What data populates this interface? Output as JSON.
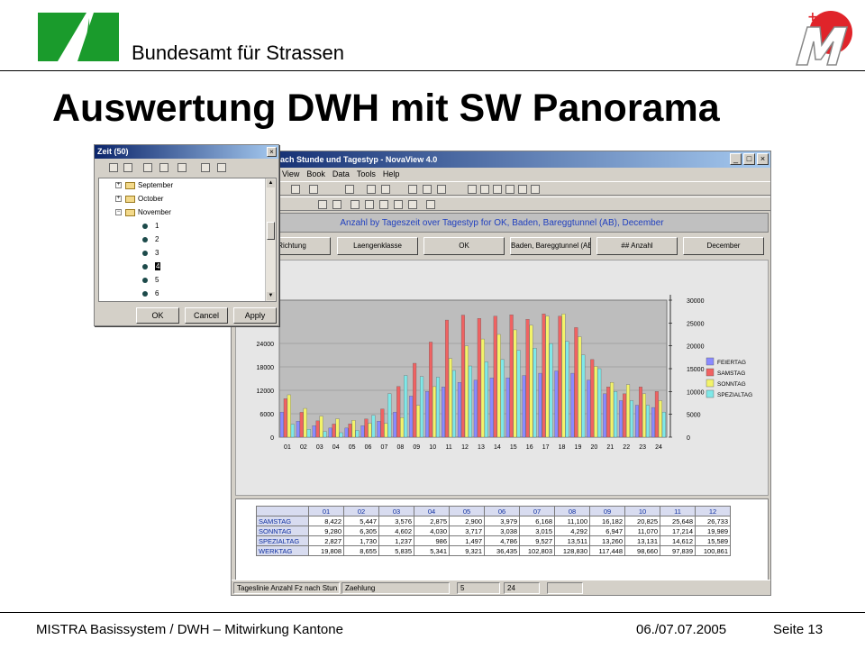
{
  "header": {
    "org_name": "Bundesamt für Strassen",
    "title": "Auswertung DWH mit SW Panorama"
  },
  "footer": {
    "left": "MISTRA Basissystem / DWH – Mitwirkung Kantone",
    "date": "06./07.07.2005",
    "page": "Seite 13"
  },
  "window": {
    "title": "Anzahl Fz nach Stunde und Tagestyp - NovaView 4.0",
    "menu": [
      "View",
      "Book",
      "Data",
      "Tools",
      "Help"
    ],
    "chart_header": "Anzahl by Tageszeit over Tagestyp for OK, Baden, Bareggtunnel (AB), December",
    "dimension_buttons": [
      "Richtung",
      "Laengenklasse",
      "OK",
      "Baden, Bareggtunnel (AB)",
      "## Anzahl",
      "December"
    ],
    "status": {
      "tab1": "Tageslinie Anzahl Fz nach Stun",
      "tab2": "Zaehlung",
      "rows": "5",
      "cols": "24"
    }
  },
  "dialog": {
    "title": "Zeit (50)",
    "tree": [
      {
        "label": "September",
        "expanded": false
      },
      {
        "label": "October",
        "expanded": false
      },
      {
        "label": "November",
        "expanded": true
      }
    ],
    "days": [
      "1",
      "2",
      "3",
      "4",
      "5",
      "6"
    ],
    "selected_day": "4",
    "buttons": {
      "ok": "OK",
      "cancel": "Cancel",
      "apply": "Apply"
    }
  },
  "grid": {
    "columns": [
      "01",
      "02",
      "03",
      "04",
      "05",
      "06",
      "07",
      "08",
      "09",
      "10",
      "11",
      "12"
    ],
    "rows": [
      {
        "label": "SAMSTAG",
        "values": [
          "8,422",
          "5,447",
          "3,576",
          "2,875",
          "2,900",
          "3,979",
          "6,168",
          "11,100",
          "16,182",
          "20,825",
          "25,648",
          "26,733"
        ]
      },
      {
        "label": "SONNTAG",
        "values": [
          "9,280",
          "6,305",
          "4,602",
          "4,030",
          "3,717",
          "3,038",
          "3,015",
          "4,292",
          "6,947",
          "11,070",
          "17,214",
          "19,989"
        ]
      },
      {
        "label": "SPEZIALTAG",
        "values": [
          "2,827",
          "1,730",
          "1,237",
          "986",
          "1,497",
          "4,786",
          "9,527",
          "13,511",
          "13,260",
          "13,131",
          "14,612",
          "15,589"
        ]
      },
      {
        "label": "WERKTAG",
        "values": [
          "19,808",
          "8,655",
          "5,835",
          "5,341",
          "9,321",
          "36,435",
          "102,803",
          "128,830",
          "117,448",
          "98,660",
          "97,839",
          "100,861"
        ]
      }
    ]
  },
  "chart_data": {
    "type": "bar",
    "categories": [
      "01",
      "02",
      "03",
      "04",
      "05",
      "06",
      "07",
      "08",
      "09",
      "10",
      "11",
      "12",
      "13",
      "14",
      "15",
      "16",
      "17",
      "18",
      "19",
      "20",
      "21",
      "22",
      "23",
      "24"
    ],
    "left_axis_ticks": [
      "0",
      "6000",
      "12000",
      "18000",
      "24000"
    ],
    "right_axis_ticks": [
      "0",
      "5000",
      "10000",
      "15000",
      "20000",
      "25000",
      "30000"
    ],
    "right_ylim": [
      0,
      30000
    ],
    "series": [
      {
        "name": "FEIERTAG",
        "color": "#8a8aff",
        "values": [
          5500,
          3500,
          2500,
          2000,
          2000,
          2500,
          3500,
          5500,
          9000,
          10000,
          11000,
          12000,
          12500,
          13000,
          13000,
          13500,
          14000,
          14500,
          14000,
          12500,
          9500,
          8000,
          7000,
          6500
        ]
      },
      {
        "name": "SAMSTAG",
        "color": "#f06262",
        "values": [
          8422,
          5447,
          3576,
          2875,
          2900,
          3979,
          6168,
          11100,
          16182,
          20825,
          25648,
          26733,
          26000,
          26500,
          26800,
          25800,
          27000,
          26500,
          24000,
          17000,
          11000,
          9500,
          11000,
          10000
        ]
      },
      {
        "name": "SONNTAG",
        "color": "#f3f36a",
        "values": [
          9280,
          6305,
          4602,
          4030,
          3717,
          3038,
          3015,
          4292,
          6947,
          11070,
          17214,
          19989,
          21500,
          22500,
          23500,
          24500,
          26500,
          27000,
          22000,
          15500,
          12000,
          11500,
          9500,
          8000
        ]
      },
      {
        "name": "SPEZIALTAG",
        "color": "#7fe8e8",
        "values": [
          2827,
          1730,
          1237,
          986,
          1497,
          4786,
          9527,
          13511,
          13260,
          13131,
          14612,
          15589,
          16500,
          17000,
          19000,
          19500,
          20500,
          21000,
          18000,
          15000,
          10000,
          8000,
          7000,
          5500
        ]
      }
    ],
    "legend": "right",
    "grid": true
  }
}
